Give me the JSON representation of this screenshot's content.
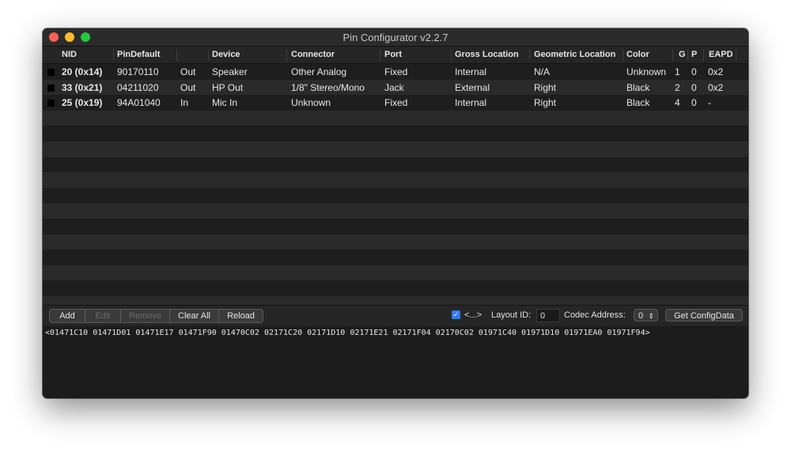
{
  "window": {
    "title": "Pin Configurator v2.2.7"
  },
  "table": {
    "columns": [
      "NID",
      "PinDefault",
      "",
      "Device",
      "Connector",
      "Port",
      "Gross Location",
      "Geometric Location",
      "Color",
      "G",
      "P",
      "EAPD"
    ],
    "rows": [
      {
        "color_hex": "#000000",
        "nid": "20 (0x14)",
        "pindefault": "90170110",
        "dir": "Out",
        "device": "Speaker",
        "connector": "Other Analog",
        "port": "Fixed",
        "gross": "Internal",
        "geometric": "N/A",
        "color": "Unknown",
        "g": "1",
        "p": "0",
        "eapd": "0x2"
      },
      {
        "color_hex": "#000000",
        "nid": "33 (0x21)",
        "pindefault": "04211020",
        "dir": "Out",
        "device": "HP Out",
        "connector": "1/8\" Stereo/Mono",
        "port": "Jack",
        "gross": "External",
        "geometric": "Right",
        "color": "Black",
        "g": "2",
        "p": "0",
        "eapd": "0x2"
      },
      {
        "color_hex": "#000000",
        "nid": "25 (0x19)",
        "pindefault": "94A01040",
        "dir": "In",
        "device": "Mic In",
        "connector": "Unknown",
        "port": "Fixed",
        "gross": "Internal",
        "geometric": "Right",
        "color": "Black",
        "g": "4",
        "p": "0",
        "eapd": "-"
      }
    ]
  },
  "toolbar": {
    "add": "Add",
    "edit": "Edit",
    "remove": "Remove",
    "clear_all": "Clear All",
    "reload": "Reload",
    "checkbox_label": "<...>",
    "checkbox_checked": true,
    "layout_id_label": "Layout ID:",
    "layout_id_value": "0",
    "codec_address_label": "Codec Address:",
    "codec_address_value": "0",
    "get_config": "Get ConfigData"
  },
  "output": {
    "text": "<01471C10 01471D01 01471E17 01471F90 01470C02 02171C20 02171D10 02171E21 02171F04 02170C02 01971C40 01971D10 01971EA0 01971F94>"
  },
  "colors": {
    "close": "#ff5f57",
    "minimize": "#febc2e",
    "maximize": "#28c840",
    "checkbox": "#2e7cf6"
  }
}
